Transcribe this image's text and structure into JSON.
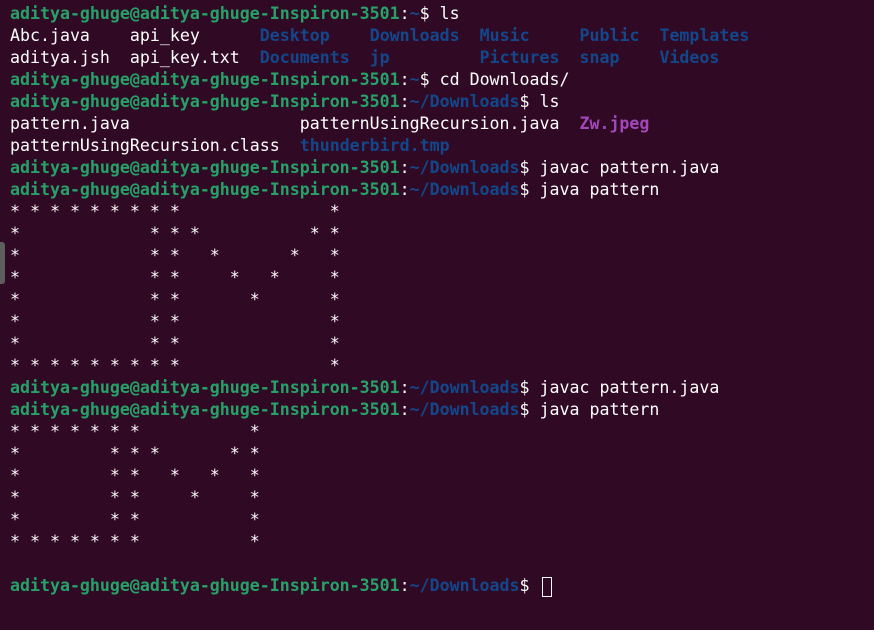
{
  "prompt": {
    "user_host": "aditya-ghuge@aditya-ghuge-Inspiron-3501",
    "colon": ":",
    "home": "~",
    "downloads": "~/Downloads",
    "dollar": "$ "
  },
  "commands": {
    "ls": "ls",
    "cd": "cd Downloads/",
    "javac": "javac pattern.java",
    "java": "java pattern"
  },
  "home_listing": {
    "row1": [
      {
        "name": "Abc.java",
        "type": "file",
        "pad": "    "
      },
      {
        "name": "api_key",
        "type": "file",
        "pad": "      "
      },
      {
        "name": "Desktop",
        "type": "dir",
        "pad": "    "
      },
      {
        "name": "Downloads",
        "type": "dir",
        "pad": "  "
      },
      {
        "name": "Music",
        "type": "dir",
        "pad": "     "
      },
      {
        "name": "Public",
        "type": "dir",
        "pad": "  "
      },
      {
        "name": "Templates",
        "type": "dir",
        "pad": ""
      }
    ],
    "row2": [
      {
        "name": "aditya.jsh",
        "type": "file",
        "pad": "  "
      },
      {
        "name": "api_key.txt",
        "type": "file",
        "pad": "  "
      },
      {
        "name": "Documents",
        "type": "dir",
        "pad": "  "
      },
      {
        "name": "jp",
        "type": "dir",
        "pad": "         "
      },
      {
        "name": "Pictures",
        "type": "dir",
        "pad": "  "
      },
      {
        "name": "snap",
        "type": "dir",
        "pad": "    "
      },
      {
        "name": "Videos",
        "type": "dir",
        "pad": ""
      }
    ]
  },
  "downloads_listing": {
    "row1": [
      {
        "name": "pattern.java",
        "type": "file",
        "pad": "                 "
      },
      {
        "name": "patternUsingRecursion.java",
        "type": "file",
        "pad": "  "
      },
      {
        "name": "Zw.jpeg",
        "type": "img",
        "pad": ""
      }
    ],
    "row2": [
      {
        "name": "patternUsingRecursion.class",
        "type": "file",
        "pad": "  "
      },
      {
        "name": "thunderbird.tmp",
        "type": "dir",
        "pad": ""
      }
    ]
  },
  "pattern1": [
    "* * * * * * * * *               *",
    "*             * * *           * *",
    "*             * *   *       *   *",
    "*             * *     *   *     *",
    "*             * *       *       *",
    "*             * *               *",
    "*             * *               *",
    "* * * * * * * * *               *"
  ],
  "pattern2": [
    "* * * * * * *           *",
    "*         * * *       * *",
    "*         * *   *   *   *",
    "*         * *     *     *",
    "*         * *           *",
    "* * * * * * *           *"
  ]
}
